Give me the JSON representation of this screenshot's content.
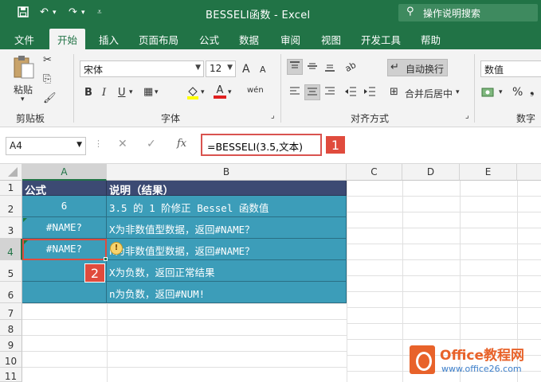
{
  "window": {
    "title": "BESSELI函数  -  Excel",
    "search_label": "操作说明搜索"
  },
  "quick_access": {
    "save_icon": "save-icon",
    "undo_icon": "undo-icon",
    "redo_icon": "redo-icon",
    "customize_icon": "customize-icon"
  },
  "tabs": [
    "文件",
    "开始",
    "插入",
    "页面布局",
    "公式",
    "数据",
    "审阅",
    "视图",
    "开发工具",
    "帮助"
  ],
  "active_tab": "开始",
  "ribbon": {
    "clipboard": {
      "paste_label": "粘贴",
      "group_label": "剪贴板"
    },
    "font": {
      "font_name": "宋体",
      "font_size": "12",
      "bold": "B",
      "italic": "I",
      "underline": "U",
      "grow": "A",
      "shrink": "A",
      "font_color": "A",
      "phonetic": "wén",
      "group_label": "字体"
    },
    "alignment": {
      "wrap_text": "自动换行",
      "merge_center": "合并后居中",
      "group_label": "对齐方式"
    },
    "number": {
      "format": "数值",
      "percent": "%",
      "group_label": "数字"
    }
  },
  "formula_bar": {
    "name_box": "A4",
    "fx": "fx",
    "formula": "=BESSELI(3.5,文本)"
  },
  "callouts": {
    "one": "1",
    "two": "2"
  },
  "sheet": {
    "columns": [
      "A",
      "B",
      "C",
      "D",
      "E"
    ],
    "rows": [
      "1",
      "2",
      "3",
      "4",
      "5",
      "6",
      "7",
      "8",
      "9",
      "10",
      "11"
    ],
    "header": {
      "a": "公式",
      "b": "说明（结果）"
    },
    "data": [
      {
        "a": "6",
        "b": "3.5 的 1 阶修正 Bessel 函数值"
      },
      {
        "a": "#NAME?",
        "b": "X为非数值型数据，返回#NAME？"
      },
      {
        "a": "#NAME?",
        "b": "n为非数值型数据，返回#NAME？"
      },
      {
        "a": "",
        "b": "X为负数，返回正常结果"
      },
      {
        "a": "",
        "b": "n为负数，返回#NUM!"
      }
    ],
    "warning_glyph": "!"
  },
  "watermark": {
    "brand": "Office教程网",
    "url": "www.office26.com"
  },
  "colors": {
    "excel_green": "#217346",
    "table_teal": "#3c9db9",
    "table_header": "#3c4a73",
    "callout_red": "#e04b3d"
  }
}
